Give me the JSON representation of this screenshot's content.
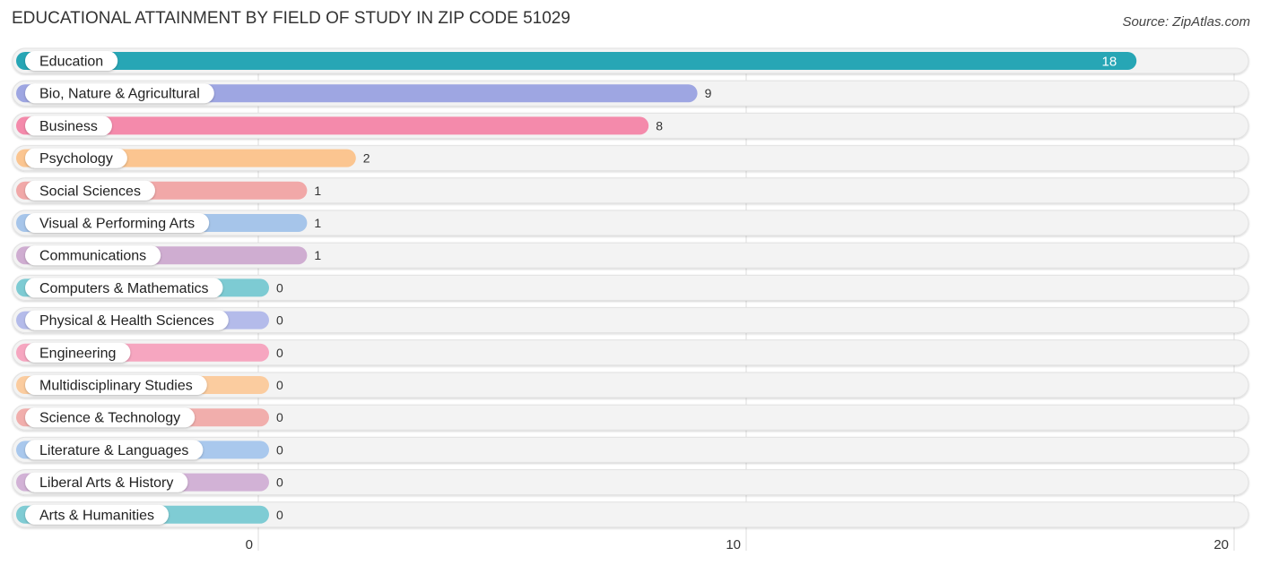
{
  "title": "EDUCATIONAL ATTAINMENT BY FIELD OF STUDY IN ZIP CODE 51029",
  "source": "Source: ZipAtlas.com",
  "chart_data": {
    "type": "bar",
    "orientation": "horizontal",
    "title": "EDUCATIONAL ATTAINMENT BY FIELD OF STUDY IN ZIP CODE 51029",
    "xlabel": "",
    "ylabel": "",
    "xlim": [
      0,
      20
    ],
    "xticks": [
      0,
      10,
      20
    ],
    "grid": true,
    "legend": "none",
    "categories": [
      "Education",
      "Bio, Nature & Agricultural",
      "Business",
      "Psychology",
      "Social Sciences",
      "Visual & Performing Arts",
      "Communications",
      "Computers & Mathematics",
      "Physical & Health Sciences",
      "Engineering",
      "Multidisciplinary Studies",
      "Science & Technology",
      "Literature & Languages",
      "Liberal Arts & History",
      "Arts & Humanities"
    ],
    "values": [
      18,
      9,
      8,
      2,
      1,
      1,
      1,
      0,
      0,
      0,
      0,
      0,
      0,
      0,
      0
    ],
    "colors": [
      "#27a6b5",
      "#9ea6e2",
      "#f48aab",
      "#fbc590",
      "#f1a8a8",
      "#a6c5ea",
      "#cfadd1",
      "#7dcbd3",
      "#b4bbea",
      "#f6a6c0",
      "#fbcc9f",
      "#f1aeac",
      "#a9c8ed",
      "#d2b2d6",
      "#7fccd4"
    ],
    "value_label_inside_first": true
  }
}
